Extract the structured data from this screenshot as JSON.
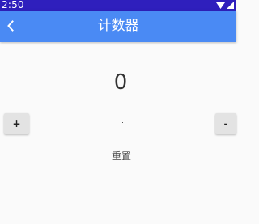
{
  "status_bar": {
    "time": "2:50",
    "icons": [
      "wifi-icon",
      "signal-icon"
    ]
  },
  "app_bar": {
    "back_icon": "back-chevron-icon",
    "title": "计数器"
  },
  "counter": {
    "value": "0",
    "increment_label": "+",
    "decrement_label": "-",
    "reset_label": "重置"
  },
  "colors": {
    "status_bar": "#2f1fbd",
    "app_bar": "#4a8af4",
    "background": "#fafafa",
    "button": "#e3e3e3"
  }
}
